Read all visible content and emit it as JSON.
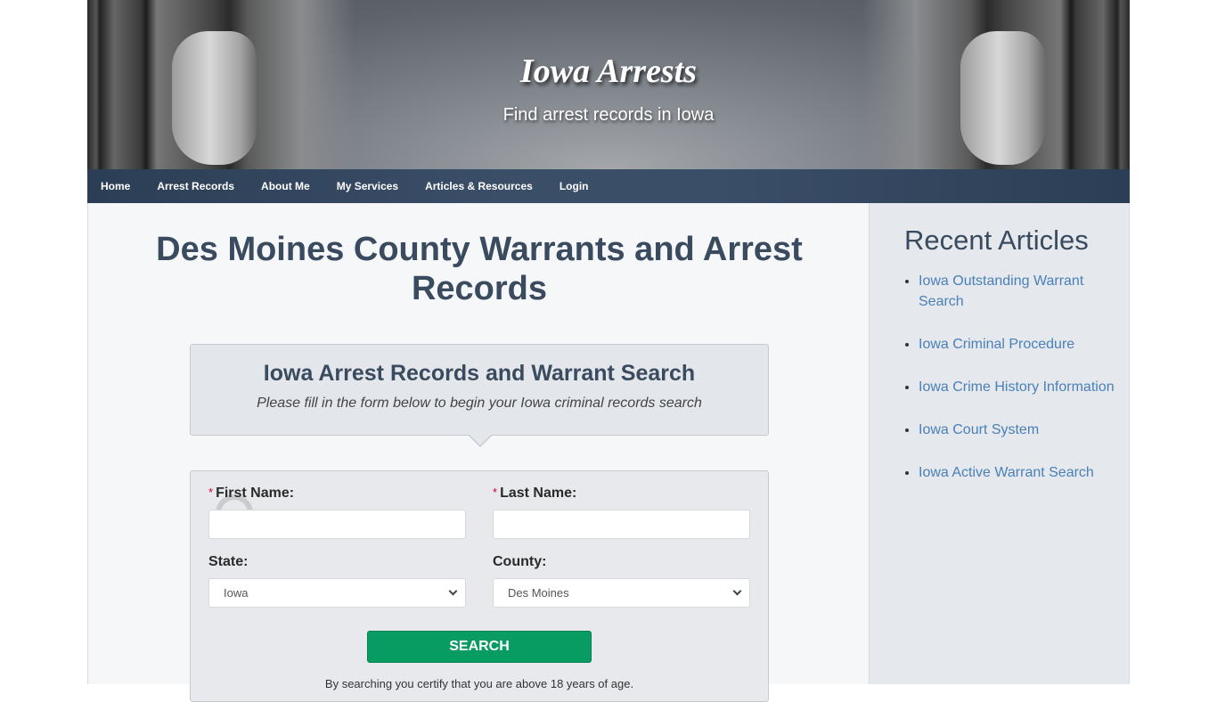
{
  "header": {
    "site_title": "Iowa Arrests",
    "tagline": "Find arrest records in Iowa"
  },
  "nav": {
    "items": [
      {
        "label": "Home"
      },
      {
        "label": "Arrest Records"
      },
      {
        "label": "About Me"
      },
      {
        "label": "My Services"
      },
      {
        "label": "Articles & Resources"
      },
      {
        "label": "Login"
      }
    ]
  },
  "main": {
    "page_title": "Des Moines County Warrants and Arrest Records",
    "promo": {
      "heading": "Iowa Arrest Records and Warrant Search",
      "subheading": "Please fill in the form below to begin your Iowa criminal records search"
    },
    "form": {
      "required_marker": "*",
      "first_name": {
        "label": "First Name:",
        "value": ""
      },
      "last_name": {
        "label": "Last Name:",
        "value": ""
      },
      "state": {
        "label": "State:",
        "selected": "Iowa"
      },
      "county": {
        "label": "County:",
        "selected": "Des Moines"
      },
      "search_label": "SEARCH",
      "disclaimer": "By searching you certify that you are above 18 years of age."
    }
  },
  "sidebar": {
    "heading": "Recent Articles",
    "articles": [
      {
        "label": "Iowa Outstanding Warrant Search"
      },
      {
        "label": "Iowa Criminal Procedure"
      },
      {
        "label": "Iowa Crime History Information"
      },
      {
        "label": "Iowa Court System"
      },
      {
        "label": "Iowa Active Warrant Search"
      }
    ]
  },
  "colors": {
    "nav_bg": "#3b4e68",
    "heading": "#3a4a5f",
    "link": "#4a80b8",
    "search_button": "#089b62",
    "required": "#d0021b"
  }
}
